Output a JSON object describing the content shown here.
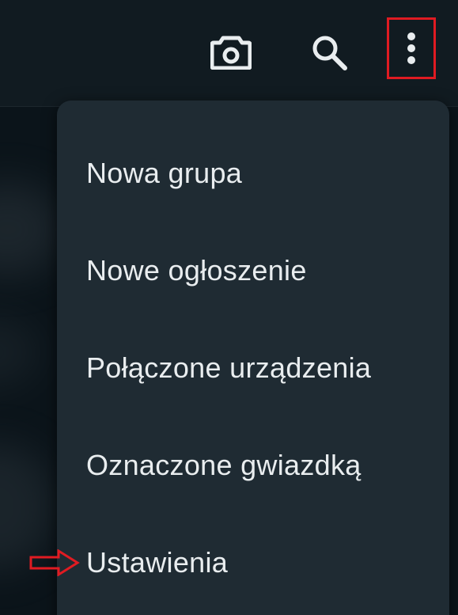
{
  "app_bar": {
    "icons": [
      "camera-icon",
      "search-icon",
      "more-vert-icon"
    ]
  },
  "menu": {
    "items": [
      {
        "label": "Nowa grupa"
      },
      {
        "label": "Nowe ogłoszenie"
      },
      {
        "label": "Połączone urządzenia"
      },
      {
        "label": "Oznaczone gwiazdką"
      },
      {
        "label": "Ustawienia"
      }
    ]
  },
  "colors": {
    "app_bar_bg": "#111b21",
    "menu_bg": "#1f2b33",
    "text": "#e9edef",
    "highlight": "#e01b22"
  }
}
